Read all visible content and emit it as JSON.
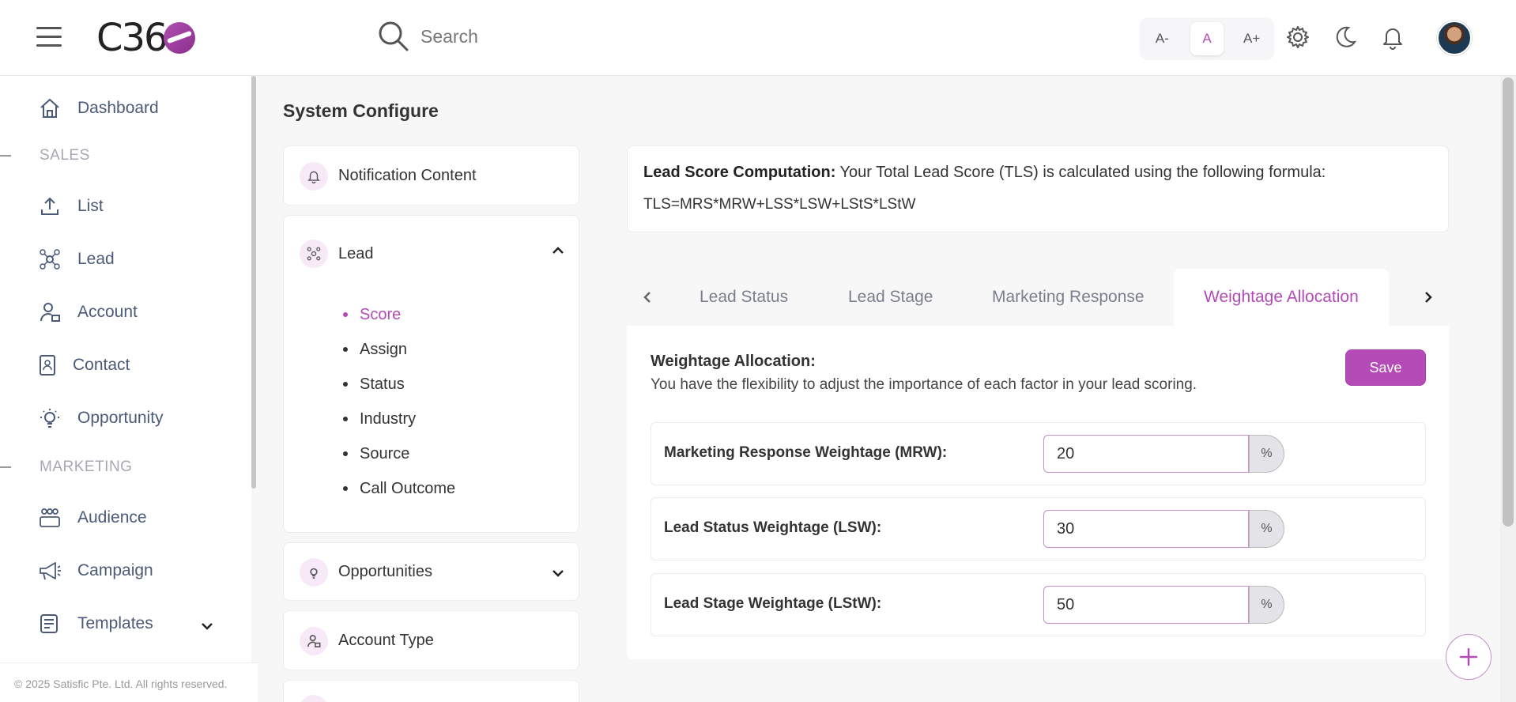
{
  "header": {
    "logo_text": "C36",
    "search_placeholder": "Search",
    "font_sizes": [
      "A-",
      "A",
      "A+"
    ]
  },
  "sidebar": {
    "items": [
      {
        "label": "Dashboard",
        "icon": "home-icon"
      },
      {
        "section": "SALES"
      },
      {
        "label": "List",
        "icon": "upload-icon"
      },
      {
        "label": "Lead",
        "icon": "network-icon"
      },
      {
        "label": "Account",
        "icon": "user-lock-icon"
      },
      {
        "label": "Contact",
        "icon": "contact-icon"
      },
      {
        "label": "Opportunity",
        "icon": "lightbulb-icon"
      },
      {
        "section": "MARKETING"
      },
      {
        "label": "Audience",
        "icon": "group-icon"
      },
      {
        "label": "Campaign",
        "icon": "megaphone-icon"
      },
      {
        "label": "Templates",
        "icon": "template-icon"
      }
    ],
    "footer": "© 2025 Satisfic Pte. Ltd. All rights reserved."
  },
  "page": {
    "title": "System Configure"
  },
  "config_menu": {
    "notification": "Notification Content",
    "lead": "Lead",
    "lead_sub": [
      "Score",
      "Assign",
      "Status",
      "Industry",
      "Source",
      "Call Outcome"
    ],
    "opportunities": "Opportunities",
    "account_type": "Account Type"
  },
  "formula": {
    "heading": "Lead Score Computation:",
    "text": " Your Total Lead Score (TLS) is calculated using the following formula:",
    "expression": "TLS=MRS*MRW+LSS*LSW+LStS*LStW"
  },
  "tabs": [
    "Lead Status",
    "Lead Stage",
    "Marketing Response",
    "Weightage Allocation"
  ],
  "panel": {
    "title": "Weightage Allocation:",
    "description": "You have the flexibility to adjust the importance of each factor in your lead scoring.",
    "save_label": "Save",
    "rows": [
      {
        "label": "Marketing Response Weightage (MRW):",
        "value": "20",
        "suffix": "%"
      },
      {
        "label": "Lead Status Weightage (LSW):",
        "value": "30",
        "suffix": "%"
      },
      {
        "label": "Lead Stage Weightage (LStW):",
        "value": "50",
        "suffix": "%"
      }
    ]
  },
  "colors": {
    "accent": "#b54bb6"
  }
}
